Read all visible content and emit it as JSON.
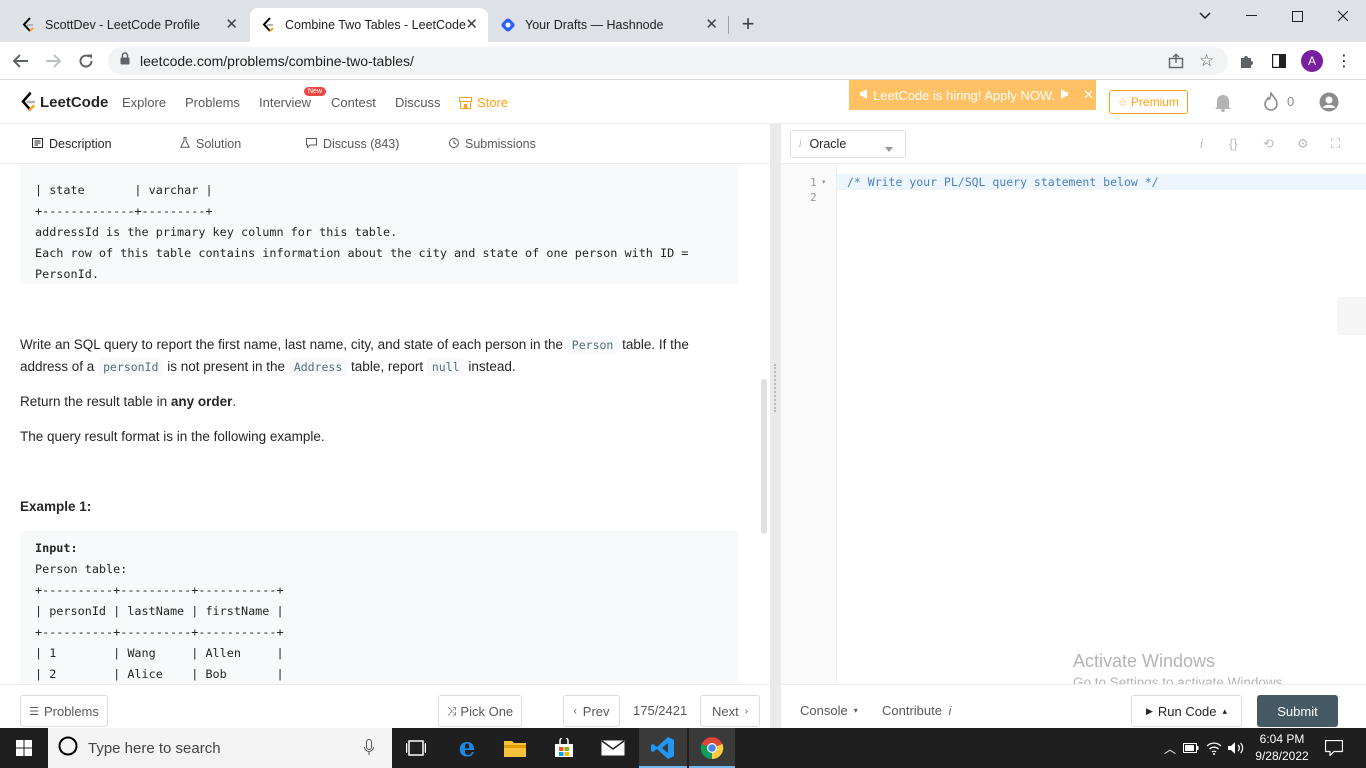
{
  "browser": {
    "tabs": [
      {
        "title": "ScottDev - LeetCode Profile",
        "active": false
      },
      {
        "title": "Combine Two Tables - LeetCode",
        "active": true
      },
      {
        "title": "Your Drafts — Hashnode",
        "active": false
      }
    ],
    "new_tab": "+",
    "url": "leetcode.com/problems/combine-two-tables/",
    "profile_initial": "A"
  },
  "header": {
    "logo": "LeetCode",
    "nav": [
      "Explore",
      "Problems",
      "Interview",
      "Contest",
      "Discuss",
      "Store"
    ],
    "new_badge": "New",
    "hiring_banner": "LeetCode is hiring! Apply NOW.",
    "premium": "Premium",
    "streak_count": "0"
  },
  "desc_tabs": [
    "Description",
    "Solution",
    "Discuss (843)",
    "Submissions"
  ],
  "address_schema_tail": [
    "| state       | varchar |",
    "+-------------+---------+",
    "addressId is the primary key column for this table.",
    "Each row of this table contains information about the city and state of one person with ID =",
    "PersonId."
  ],
  "body": {
    "p1_a": "Write an SQL query to report the first name, last name, city, and state of each person in the",
    "p1_code1": "Person",
    "p1_b": "table. If the",
    "p1_c": "address of a",
    "p1_code2": "personId",
    "p1_d": "is not present in the",
    "p1_code3": "Address",
    "p1_e": "table, report",
    "p1_code4": "null",
    "p1_f": "instead.",
    "p2_a": "Return the result table in",
    "p2_bold": "any order",
    "p2_b": ".",
    "p3": "The query result format is in the following example.",
    "example_title": "Example 1:"
  },
  "example_block": [
    "Input:",
    "Person table:",
    "+----------+----------+-----------+",
    "| personId | lastName | firstName |",
    "+----------+----------+-----------+",
    "| 1        | Wang     | Allen     |",
    "| 2        | Alice    | Bob       |"
  ],
  "left_footer": {
    "problems": "Problems",
    "pick_one": "Pick One",
    "prev": "Prev",
    "counter": "175/2421",
    "next": "Next"
  },
  "editor": {
    "language": "Oracle",
    "line_numbers": [
      "1",
      "2"
    ],
    "code_line1": "/* Write your PL/SQL query statement below */"
  },
  "right_footer": {
    "console": "Console",
    "contribute": "Contribute",
    "run_code": "Run Code",
    "submit": "Submit"
  },
  "watermark": {
    "title": "Activate Windows",
    "subtitle": "Go to Settings to activate Windows."
  },
  "taskbar": {
    "search_placeholder": "Type here to search",
    "time": "6:04 PM",
    "date": "9/28/2022"
  },
  "colors": {
    "accent": "#ffa116",
    "hiring_bg": "#ffc163",
    "submit_bg": "#455a64",
    "taskbar_bg": "#1f1f1f"
  }
}
